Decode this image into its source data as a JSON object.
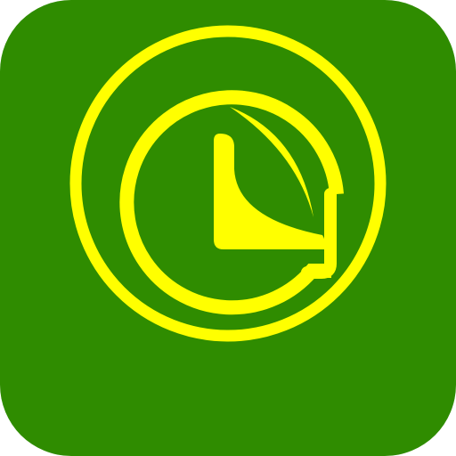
{
  "app_icon": {
    "icon_name": "clock-leaf-icon",
    "colors": {
      "background": "#2f8c00",
      "symbol": "#ffff00",
      "page": "#ffffff"
    }
  }
}
